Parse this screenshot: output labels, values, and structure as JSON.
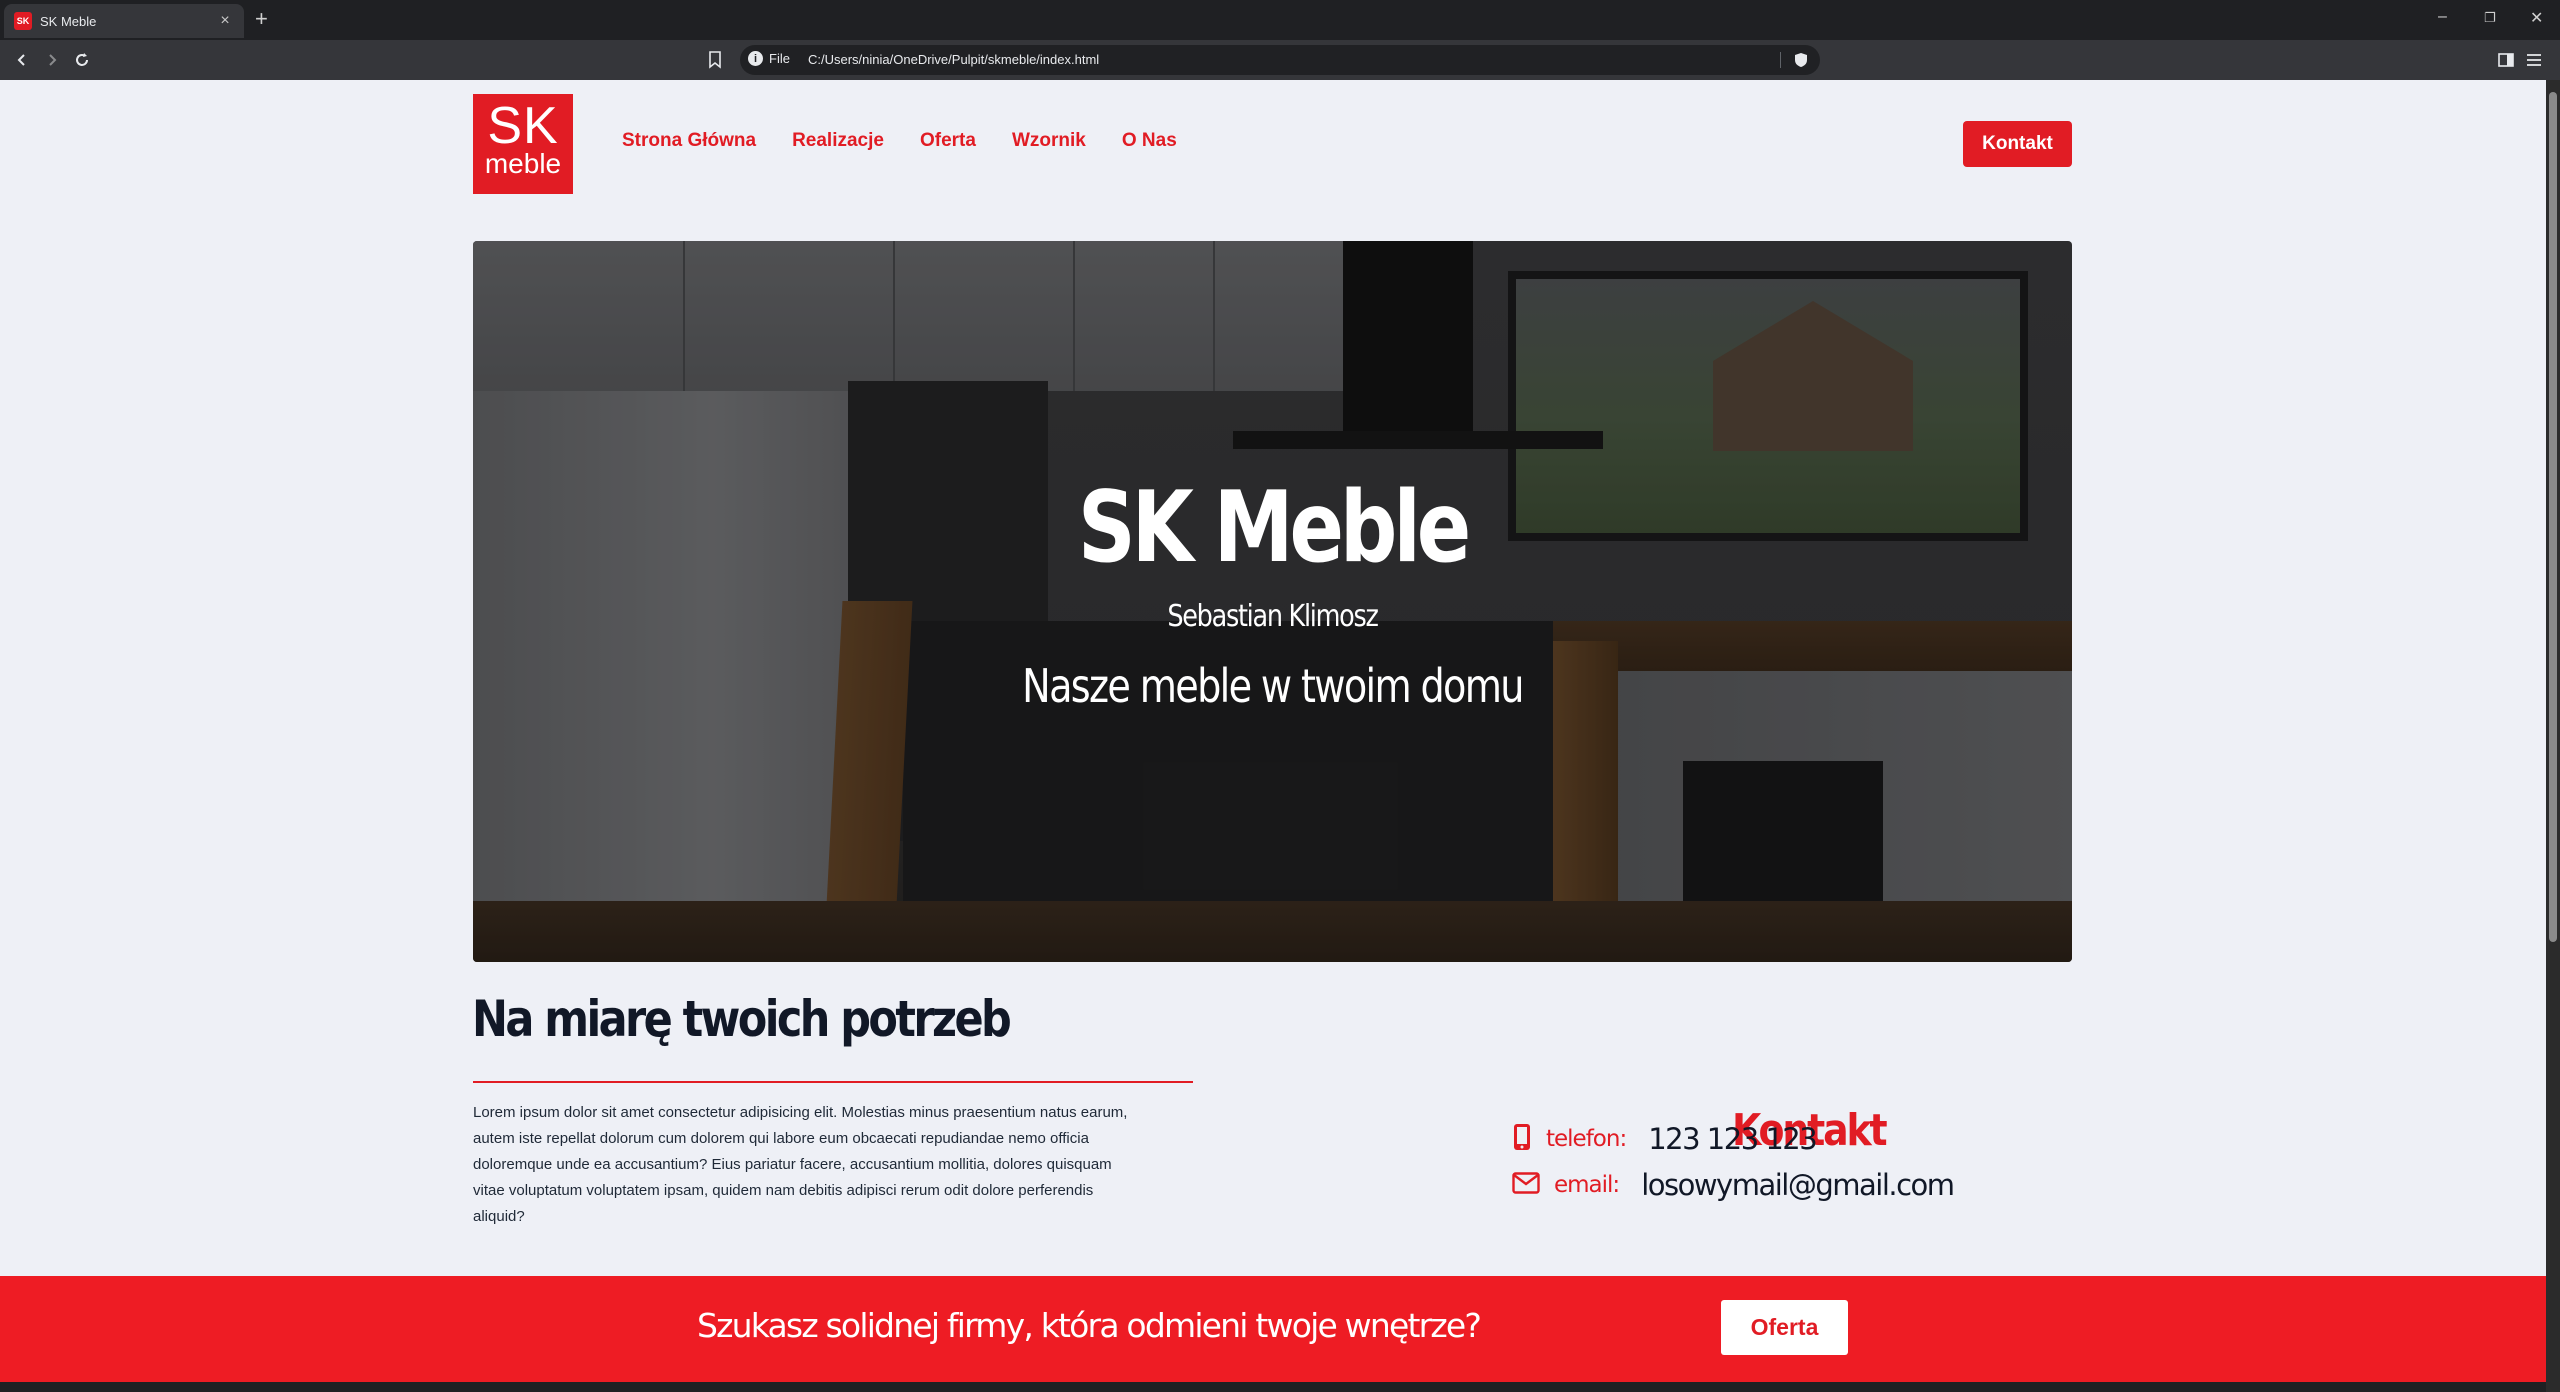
{
  "browser": {
    "tab_title": "SK Meble",
    "tab_favicon": "SK",
    "omnibox_scheme": "File",
    "url": "C:/Users/ninia/OneDrive/Pulpit/skmeble/index.html"
  },
  "header": {
    "logo_top": "SK",
    "logo_bottom": "meble",
    "nav": [
      "Strona Główna",
      "Realizacje",
      "Oferta",
      "Wzornik",
      "O Nas"
    ],
    "contact_button": "Kontakt"
  },
  "hero": {
    "title": "SK Meble",
    "subtitle": "Sebastian Klimosz",
    "tagline": "Nasze meble w twoim domu"
  },
  "about": {
    "title": "Na miarę twoich potrzeb",
    "text": "Lorem ipsum dolor sit amet consectetur adipisicing elit. Molestias minus praesentium natus earum, autem iste repellat dolorum cum dolorem qui labore eum obcaecati repudiandae nemo officia doloremque unde ea accusantium? Eius pariatur facere, accusantium mollitia, dolores quisquam vitae voluptatum voluptatem ipsam, quidem nam debitis adipisci rerum odit dolore perferendis aliquid?"
  },
  "contact": {
    "title": "Kontakt",
    "phone_label": "telefon:",
    "phone": "123 123 123",
    "email_label": "email:",
    "email": "losowymail@gmail.com"
  },
  "cta": {
    "text": "Szukasz solidnej firmy, która odmieni twoje wnętrze?",
    "button": "Oferta"
  },
  "colors": {
    "brand_red": "#e11c24",
    "page_bg": "#eef0f6",
    "dark_text": "#111827"
  }
}
